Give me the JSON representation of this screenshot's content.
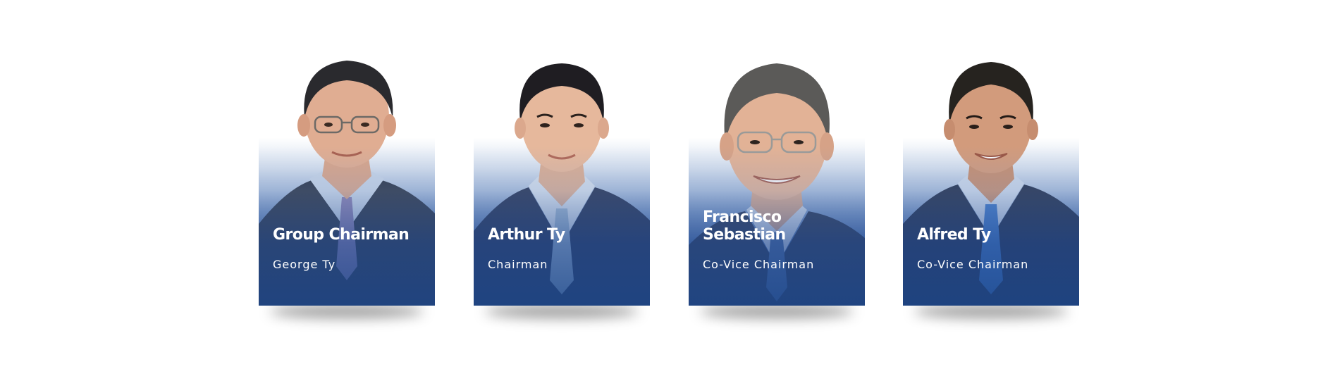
{
  "leaders": [
    {
      "title": "Group Chairman",
      "subtitle": "George Ty",
      "icon": "portrait-photo",
      "tie_color": "#8a7fb0"
    },
    {
      "title": "Arthur Ty",
      "subtitle": "Chairman",
      "icon": "portrait-photo",
      "tie_color": "#9fb7d0"
    },
    {
      "title": "Francisco\nSebastian",
      "subtitle": "Co-Vice Chairman",
      "icon": "portrait-photo",
      "tie_color": "#4a6aa0"
    },
    {
      "title": "Alfred Ty",
      "subtitle": "Co-Vice Chairman",
      "icon": "portrait-photo",
      "tie_color": "#3f78c8"
    }
  ],
  "colors": {
    "brand_blue": "#1f4a8e",
    "text": "#ffffff"
  }
}
